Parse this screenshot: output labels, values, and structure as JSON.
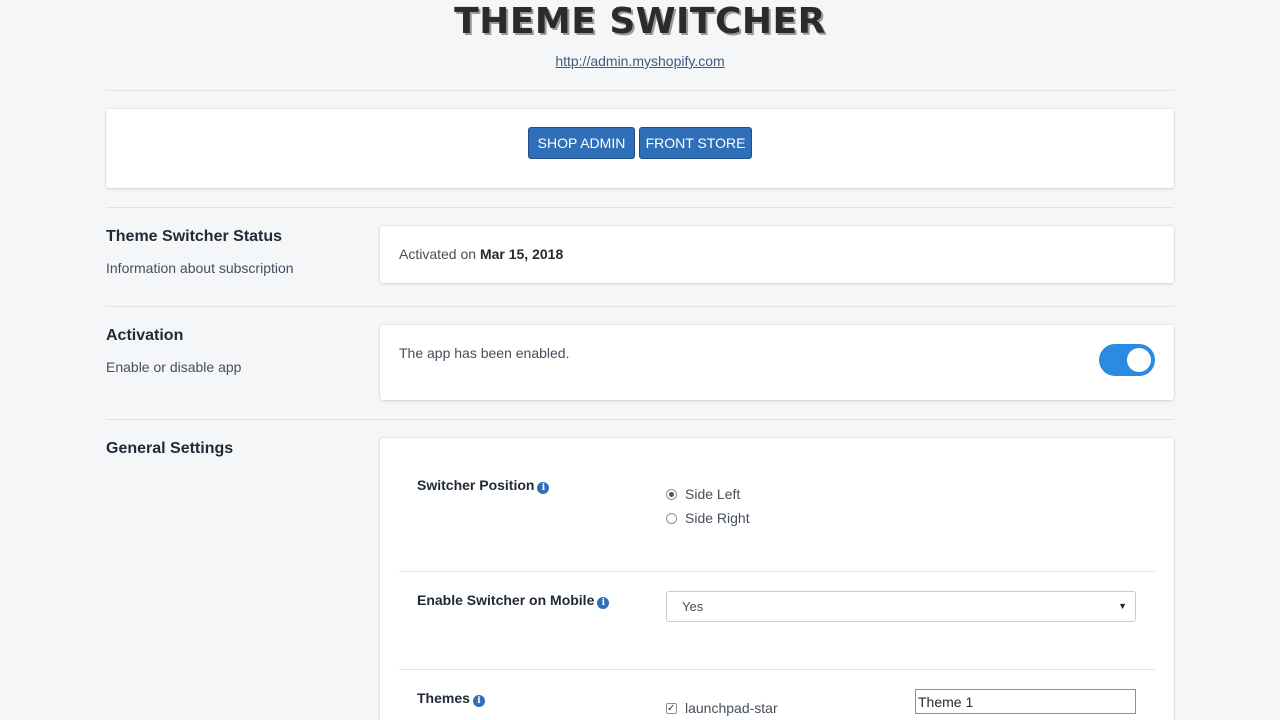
{
  "header": {
    "title": "THEME SWITCHER",
    "link": "http://admin.myshopify.com"
  },
  "actions": {
    "shop_admin": "SHOP ADMIN",
    "front_store": "FRONT STORE"
  },
  "status": {
    "title": "Theme Switcher Status",
    "description": "Information about subscription",
    "activated_prefix": "Activated on",
    "activated_date": "Mar 15, 2018"
  },
  "activation": {
    "title": "Activation",
    "description": "Enable or disable app",
    "message": "The app has been enabled.",
    "enabled": true,
    "accent_color": "#2b8ae2"
  },
  "general": {
    "title": "General Settings",
    "switcher_position": {
      "label": "Switcher Position",
      "options": [
        "Side Left",
        "Side Right"
      ],
      "selected": "Side Left"
    },
    "mobile": {
      "label": "Enable Switcher on Mobile",
      "value": "Yes"
    },
    "themes": {
      "label": "Themes",
      "items": [
        {
          "name": "launchpad-star",
          "checked": true,
          "display_name": "Theme 1"
        }
      ]
    }
  },
  "colors": {
    "button": "#2f6fb7",
    "background": "#f4f6f8",
    "icon": "info-icon"
  }
}
